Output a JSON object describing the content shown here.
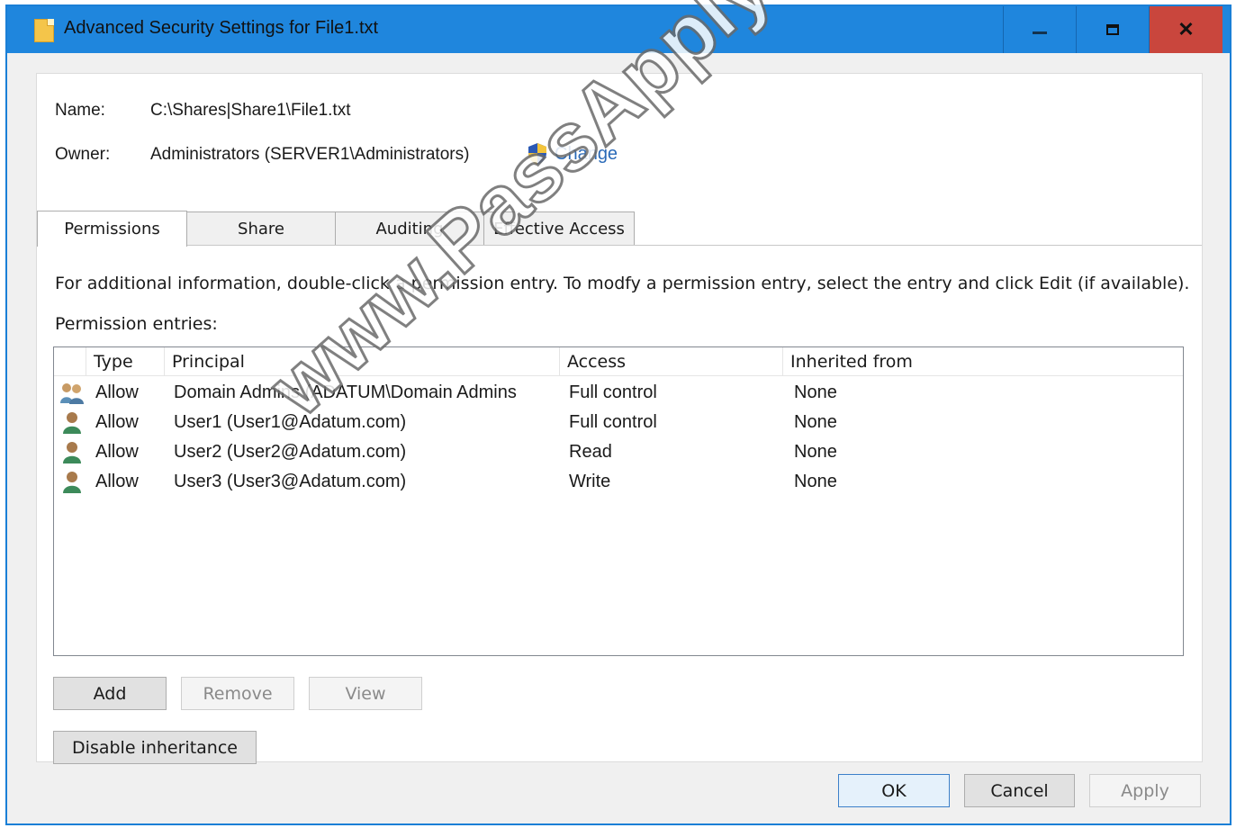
{
  "window": {
    "title": "Advanced Security Settings for File1.txt",
    "controls": {
      "minimize": "minimize",
      "maximize": "maximize",
      "close": "close"
    }
  },
  "general": {
    "name_label": "Name:",
    "name_value": "C:\\Shares|Share1\\File1.txt",
    "owner_label": "Owner:",
    "owner_value": "Administrators (SERVER1\\Administrators)",
    "change_label": "Change"
  },
  "tabs": [
    {
      "label": "Permissions",
      "active": true
    },
    {
      "label": "Share",
      "active": false
    },
    {
      "label": "Auditing",
      "active": false
    },
    {
      "label": "Effective Access",
      "active": false
    }
  ],
  "permissions": {
    "info_text": "For additional information, double-click a permission entry. To modfy a permission entry, select the entry and click Edit (if available).",
    "entries_label": "Permission entries:",
    "columns": [
      "Type",
      "Principal",
      "Access",
      "Inherited from"
    ],
    "rows": [
      {
        "icon": "group-icon",
        "type": "Allow",
        "principal": "Domain Admins (ADATUM\\Domain Admins",
        "access": "Full control",
        "inherited": "None"
      },
      {
        "icon": "user-icon",
        "type": "Allow",
        "principal": "User1 (User1@Adatum.com)",
        "access": "Full control",
        "inherited": "None"
      },
      {
        "icon": "user-icon",
        "type": "Allow",
        "principal": "User2 (User2@Adatum.com)",
        "access": "Read",
        "inherited": "None"
      },
      {
        "icon": "user-icon",
        "type": "Allow",
        "principal": "User3 (User3@Adatum.com)",
        "access": "Write",
        "inherited": "None"
      }
    ]
  },
  "actions": {
    "add": "Add",
    "remove": "Remove",
    "view": "View",
    "disable_inheritance": "Disable inheritance"
  },
  "footer": {
    "ok": "OK",
    "cancel": "Cancel",
    "apply": "Apply"
  },
  "watermark": "www.PassApply.com",
  "colors": {
    "titlebar": "#1f86dd",
    "close": "#c9463d",
    "link": "#2a6ab8"
  }
}
